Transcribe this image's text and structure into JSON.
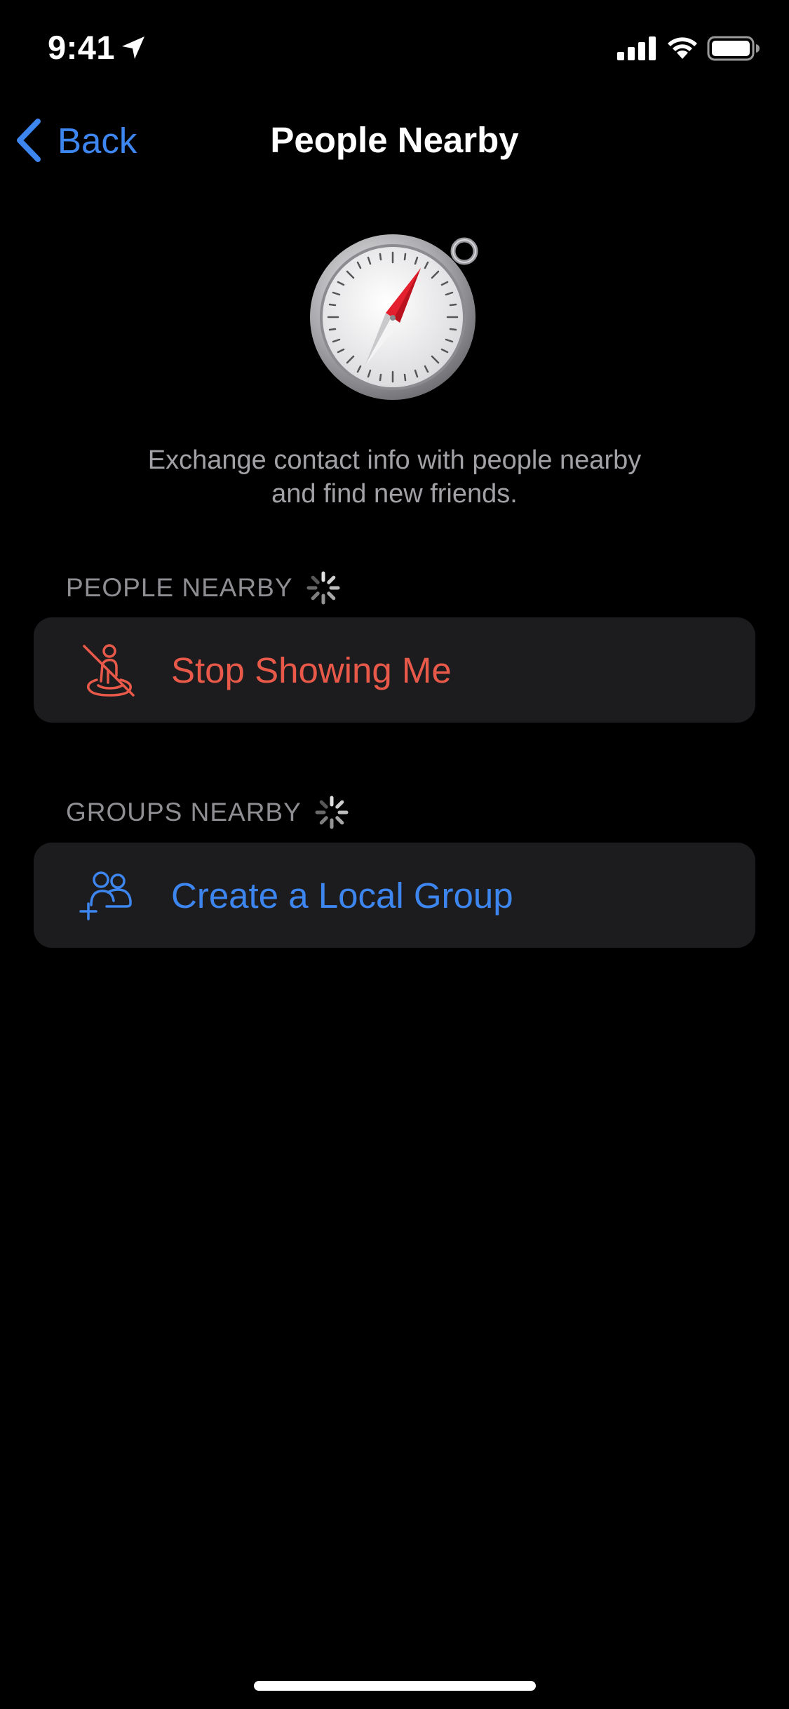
{
  "status_bar": {
    "time": "9:41",
    "icons": [
      "location-arrow-icon",
      "cellular-signal-icon",
      "wifi-icon",
      "battery-icon"
    ]
  },
  "nav": {
    "back_label": "Back",
    "title": "People Nearby"
  },
  "hero": {
    "icon": "compass-icon",
    "description_line1": "Exchange contact info with people nearby",
    "description_line2": "and find new friends."
  },
  "sections": {
    "people": {
      "header": "PEOPLE NEARBY",
      "item_label": "Stop Showing Me",
      "item_icon": "stop-showing-location-icon"
    },
    "groups": {
      "header": "GROUPS NEARBY",
      "item_label": "Create a Local Group",
      "item_icon": "add-group-icon"
    }
  },
  "colors": {
    "background": "#000000",
    "cell_background": "#1c1c1e",
    "accent_blue": "#3d86f0",
    "destructive_red": "#e8594a",
    "secondary_text": "#8e8e93"
  }
}
